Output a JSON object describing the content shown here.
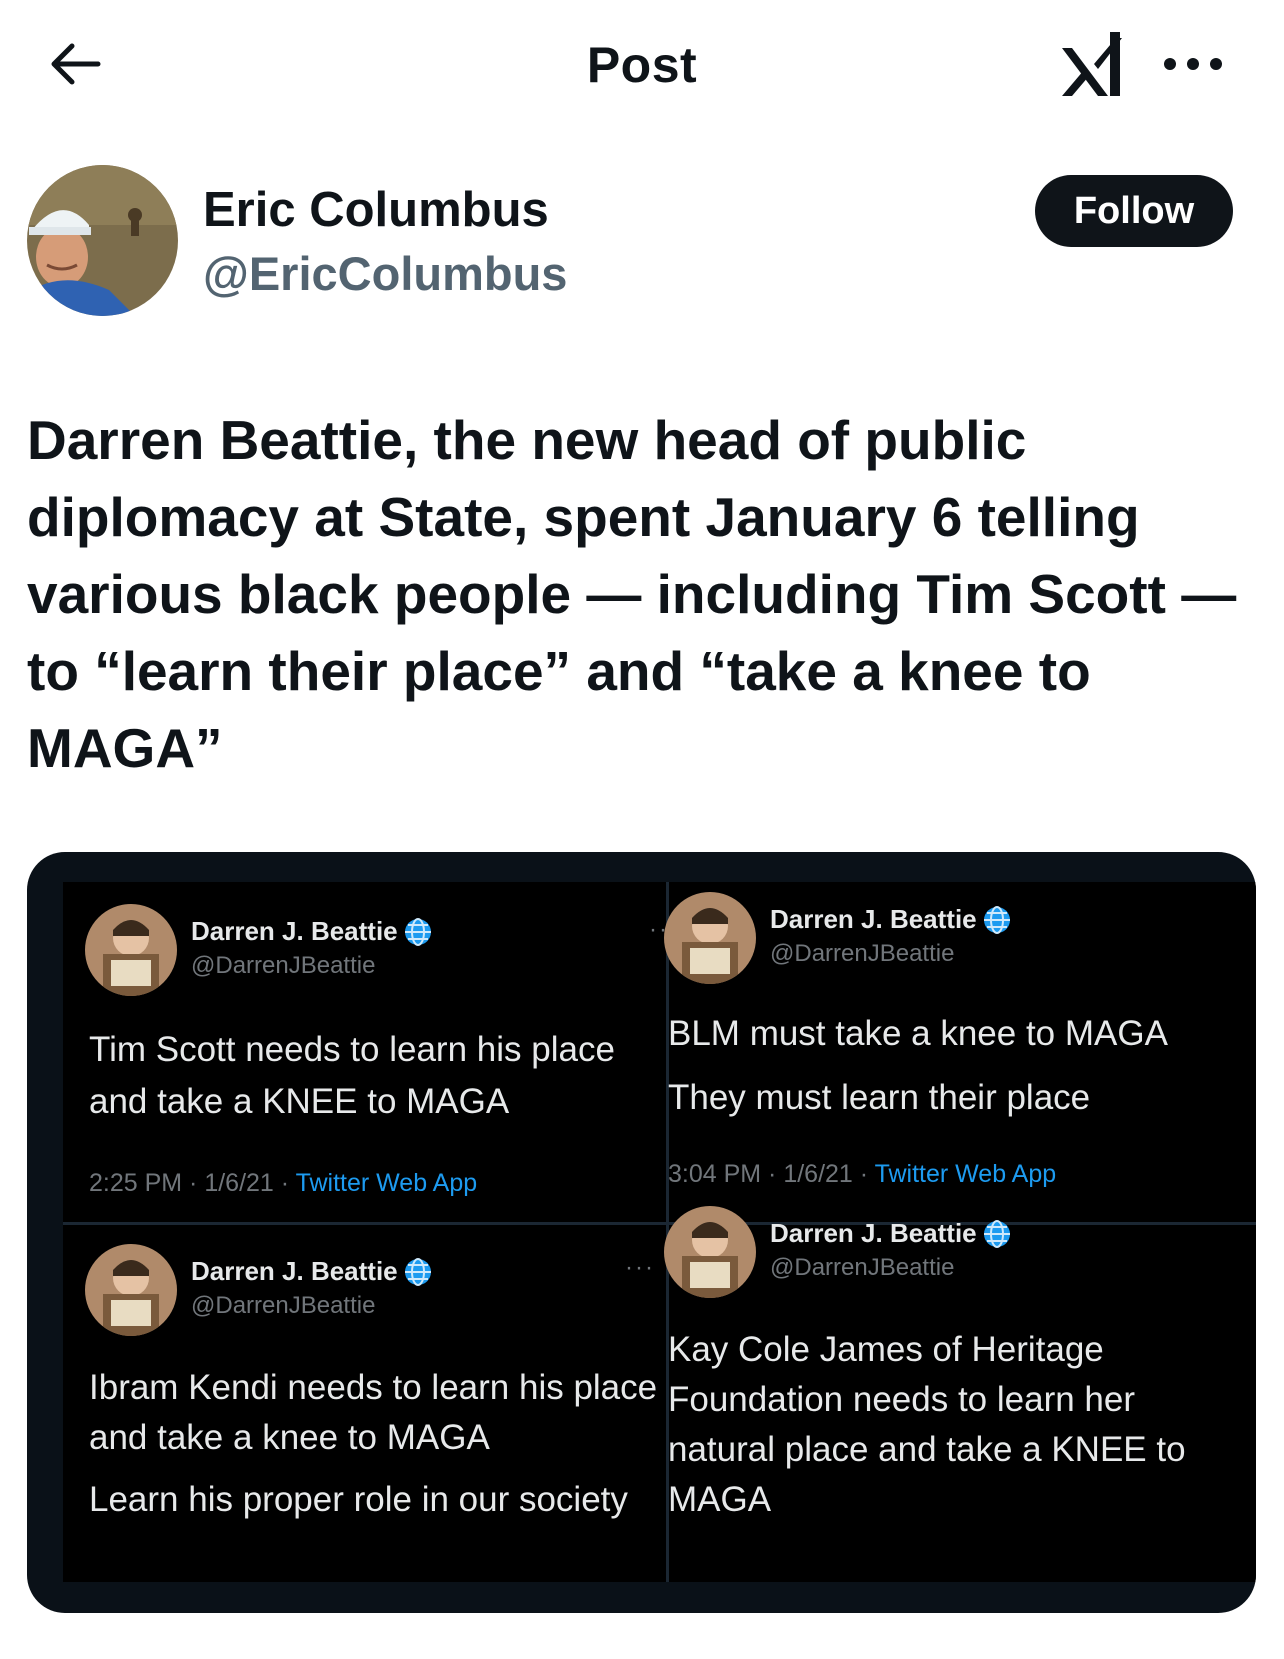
{
  "header": {
    "title": "Post"
  },
  "author": {
    "name": "Eric Columbus",
    "handle": "@EricColumbus",
    "follow_label": "Follow"
  },
  "post": {
    "text": "Darren Beattie, the new head of public diplomacy at State, spent January 6 telling various black people — including Tim Scott — to “learn their place” and “take a knee to MAGA”"
  },
  "media": {
    "tweets": [
      {
        "name": "Darren J. Beattie",
        "handle": "@DarrenJBeattie",
        "lines": [
          "Tim Scott needs to learn his place",
          "and take a KNEE to MAGA"
        ],
        "time": "2:25 PM · 1/6/21 · ",
        "app": "Twitter Web App"
      },
      {
        "name": "Darren J. Beattie",
        "handle": "@DarrenJBeattie",
        "lines": [
          "BLM must take a knee to MAGA",
          "They must learn their place"
        ],
        "time": "3:04 PM · 1/6/21 · ",
        "app": "Twitter Web App"
      },
      {
        "name": "Darren J. Beattie",
        "handle": "@DarrenJBeattie",
        "lines": [
          "Ibram Kendi needs to learn his place",
          "and take a knee to MAGA",
          "Learn his proper role in our society"
        ]
      },
      {
        "name": "Darren J. Beattie",
        "handle": "@DarrenJBeattie",
        "lines": [
          "Kay Cole James of Heritage",
          "Foundation needs to learn her",
          "natural place and take a KNEE to",
          "MAGA"
        ]
      }
    ]
  },
  "icons": {
    "back": "arrow-left-icon",
    "grok": "grok-icon",
    "more": "more-horizontal-icon",
    "verified": "globe-badge-icon"
  },
  "colors": {
    "text": "#0f1419",
    "secondary": "#536471",
    "link": "#1d9bf0",
    "media_bg": "#000000"
  }
}
